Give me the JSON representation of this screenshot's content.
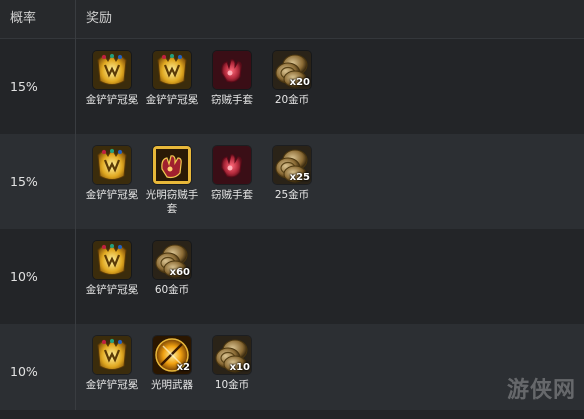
{
  "header": {
    "col_probability": "概率",
    "col_reward": "奖励"
  },
  "rows": [
    {
      "probability": "15%",
      "items": [
        {
          "label": "金铲铲冠冕",
          "icon": "golden-crown-icon",
          "qty": ""
        },
        {
          "label": "金铲铲冠冕",
          "icon": "golden-crown-icon",
          "qty": ""
        },
        {
          "label": "窃贼手套",
          "icon": "thiefs-gloves-icon",
          "qty": ""
        },
        {
          "label": "20金币",
          "icon": "gold-coins-icon",
          "qty": "x20"
        }
      ]
    },
    {
      "probability": "15%",
      "items": [
        {
          "label": "金铲铲冠冕",
          "icon": "golden-crown-icon",
          "qty": ""
        },
        {
          "label": "光明窃贼手套",
          "icon": "radiant-thiefs-gloves-icon",
          "qty": ""
        },
        {
          "label": "窃贼手套",
          "icon": "thiefs-gloves-icon",
          "qty": ""
        },
        {
          "label": "25金币",
          "icon": "gold-coins-icon",
          "qty": "x25"
        }
      ]
    },
    {
      "probability": "10%",
      "items": [
        {
          "label": "金铲铲冠冕",
          "icon": "golden-crown-icon",
          "qty": ""
        },
        {
          "label": "60金币",
          "icon": "gold-coins-icon",
          "qty": "x60"
        }
      ]
    },
    {
      "probability": "10%",
      "items": [
        {
          "label": "金铲铲冠冕",
          "icon": "golden-crown-icon",
          "qty": ""
        },
        {
          "label": "光明武器",
          "icon": "radiant-weapon-icon",
          "qty": "x2"
        },
        {
          "label": "10金币",
          "icon": "gold-coins-icon",
          "qty": "x10"
        }
      ]
    }
  ],
  "watermark": "游侠网",
  "colors": {
    "background": "#222427",
    "row_alt": "#2c2f33",
    "gold": "#e2b23a",
    "glove_red": "#b0283a"
  }
}
